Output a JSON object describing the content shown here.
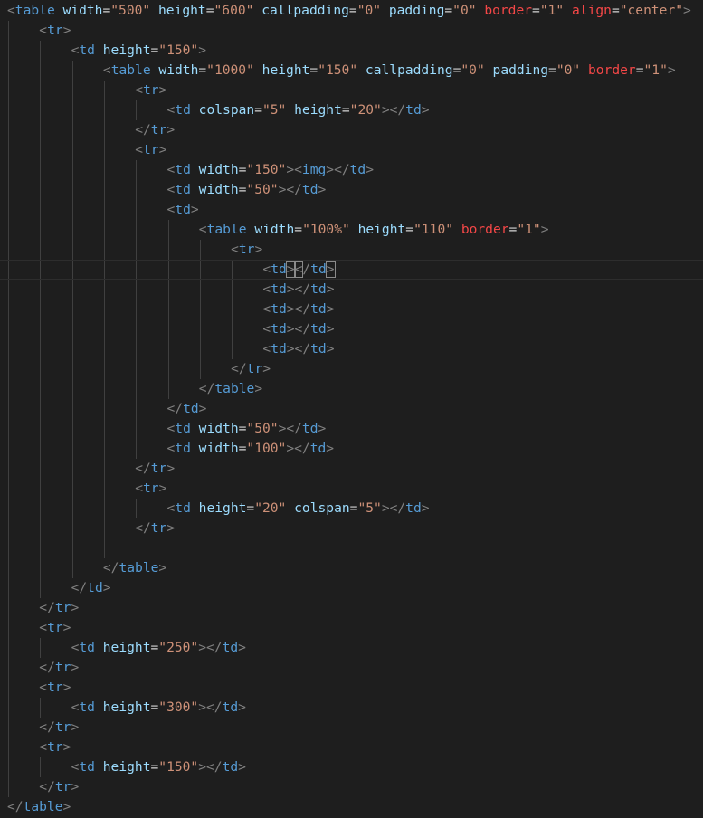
{
  "theme": {
    "background": "#1e1e1e",
    "bracket": "#808080",
    "tag": "#569cd6",
    "attribute": "#9cdcfe",
    "invalid_attribute": "#f44747",
    "string": "#ce9178",
    "text": "#d4d4d4"
  },
  "code_lines": [
    {
      "indent": 0,
      "tokens": [
        {
          "t": "br",
          "v": "<"
        },
        {
          "t": "tag",
          "v": "table"
        },
        {
          "t": "txt",
          "v": " "
        },
        {
          "t": "attr",
          "v": "width"
        },
        {
          "t": "txt",
          "v": "="
        },
        {
          "t": "val",
          "v": "\"500\""
        },
        {
          "t": "txt",
          "v": " "
        },
        {
          "t": "attr",
          "v": "height"
        },
        {
          "t": "txt",
          "v": "="
        },
        {
          "t": "val",
          "v": "\"600\""
        },
        {
          "t": "txt",
          "v": " "
        },
        {
          "t": "attr",
          "v": "callpadding"
        },
        {
          "t": "txt",
          "v": "="
        },
        {
          "t": "val",
          "v": "\"0\""
        },
        {
          "t": "txt",
          "v": " "
        },
        {
          "t": "attr",
          "v": "padding"
        },
        {
          "t": "txt",
          "v": "="
        },
        {
          "t": "val",
          "v": "\"0\""
        },
        {
          "t": "txt",
          "v": " "
        },
        {
          "t": "attr-red",
          "v": "border"
        },
        {
          "t": "txt",
          "v": "="
        },
        {
          "t": "val",
          "v": "\"1\""
        },
        {
          "t": "txt",
          "v": " "
        },
        {
          "t": "attr-red",
          "v": "align"
        },
        {
          "t": "txt",
          "v": "="
        },
        {
          "t": "val",
          "v": "\"center\""
        },
        {
          "t": "br",
          "v": ">"
        }
      ]
    },
    {
      "indent": 1,
      "tokens": [
        {
          "t": "br",
          "v": "<"
        },
        {
          "t": "tag",
          "v": "tr"
        },
        {
          "t": "br",
          "v": ">"
        }
      ]
    },
    {
      "indent": 2,
      "tokens": [
        {
          "t": "br",
          "v": "<"
        },
        {
          "t": "tag",
          "v": "td"
        },
        {
          "t": "txt",
          "v": " "
        },
        {
          "t": "attr",
          "v": "height"
        },
        {
          "t": "txt",
          "v": "="
        },
        {
          "t": "val",
          "v": "\"150\""
        },
        {
          "t": "br",
          "v": ">"
        }
      ]
    },
    {
      "indent": 3,
      "tokens": [
        {
          "t": "br",
          "v": "<"
        },
        {
          "t": "tag",
          "v": "table"
        },
        {
          "t": "txt",
          "v": " "
        },
        {
          "t": "attr",
          "v": "width"
        },
        {
          "t": "txt",
          "v": "="
        },
        {
          "t": "val",
          "v": "\"1000\""
        },
        {
          "t": "txt",
          "v": " "
        },
        {
          "t": "attr",
          "v": "height"
        },
        {
          "t": "txt",
          "v": "="
        },
        {
          "t": "val",
          "v": "\"150\""
        },
        {
          "t": "txt",
          "v": " "
        },
        {
          "t": "attr",
          "v": "callpadding"
        },
        {
          "t": "txt",
          "v": "="
        },
        {
          "t": "val",
          "v": "\"0\""
        },
        {
          "t": "txt",
          "v": " "
        },
        {
          "t": "attr",
          "v": "padding"
        },
        {
          "t": "txt",
          "v": "="
        },
        {
          "t": "val",
          "v": "\"0\""
        },
        {
          "t": "txt",
          "v": " "
        },
        {
          "t": "attr-red",
          "v": "border"
        },
        {
          "t": "txt",
          "v": "="
        },
        {
          "t": "val",
          "v": "\"1\""
        },
        {
          "t": "br",
          "v": ">"
        }
      ]
    },
    {
      "indent": 4,
      "tokens": [
        {
          "t": "br",
          "v": "<"
        },
        {
          "t": "tag",
          "v": "tr"
        },
        {
          "t": "br",
          "v": ">"
        }
      ]
    },
    {
      "indent": 5,
      "tokens": [
        {
          "t": "br",
          "v": "<"
        },
        {
          "t": "tag",
          "v": "td"
        },
        {
          "t": "txt",
          "v": " "
        },
        {
          "t": "attr",
          "v": "colspan"
        },
        {
          "t": "txt",
          "v": "="
        },
        {
          "t": "val",
          "v": "\"5\""
        },
        {
          "t": "txt",
          "v": " "
        },
        {
          "t": "attr",
          "v": "height"
        },
        {
          "t": "txt",
          "v": "="
        },
        {
          "t": "val",
          "v": "\"20\""
        },
        {
          "t": "br",
          "v": "></"
        },
        {
          "t": "tag",
          "v": "td"
        },
        {
          "t": "br",
          "v": ">"
        }
      ]
    },
    {
      "indent": 4,
      "tokens": [
        {
          "t": "br",
          "v": "</"
        },
        {
          "t": "tag",
          "v": "tr"
        },
        {
          "t": "br",
          "v": ">"
        }
      ]
    },
    {
      "indent": 4,
      "tokens": [
        {
          "t": "br",
          "v": "<"
        },
        {
          "t": "tag",
          "v": "tr"
        },
        {
          "t": "br",
          "v": ">"
        }
      ]
    },
    {
      "indent": 5,
      "tokens": [
        {
          "t": "br",
          "v": "<"
        },
        {
          "t": "tag",
          "v": "td"
        },
        {
          "t": "txt",
          "v": " "
        },
        {
          "t": "attr",
          "v": "width"
        },
        {
          "t": "txt",
          "v": "="
        },
        {
          "t": "val",
          "v": "\"150\""
        },
        {
          "t": "br",
          "v": "><"
        },
        {
          "t": "tag",
          "v": "img"
        },
        {
          "t": "br",
          "v": "></"
        },
        {
          "t": "tag",
          "v": "td"
        },
        {
          "t": "br",
          "v": ">"
        }
      ]
    },
    {
      "indent": 5,
      "tokens": [
        {
          "t": "br",
          "v": "<"
        },
        {
          "t": "tag",
          "v": "td"
        },
        {
          "t": "txt",
          "v": " "
        },
        {
          "t": "attr",
          "v": "width"
        },
        {
          "t": "txt",
          "v": "="
        },
        {
          "t": "val",
          "v": "\"50\""
        },
        {
          "t": "br",
          "v": "></"
        },
        {
          "t": "tag",
          "v": "td"
        },
        {
          "t": "br",
          "v": ">"
        }
      ]
    },
    {
      "indent": 5,
      "tokens": [
        {
          "t": "br",
          "v": "<"
        },
        {
          "t": "tag",
          "v": "td"
        },
        {
          "t": "br",
          "v": ">"
        }
      ]
    },
    {
      "indent": 6,
      "tokens": [
        {
          "t": "br",
          "v": "<"
        },
        {
          "t": "tag",
          "v": "table"
        },
        {
          "t": "txt",
          "v": " "
        },
        {
          "t": "attr",
          "v": "width"
        },
        {
          "t": "txt",
          "v": "="
        },
        {
          "t": "val",
          "v": "\"100%\""
        },
        {
          "t": "txt",
          "v": " "
        },
        {
          "t": "attr",
          "v": "height"
        },
        {
          "t": "txt",
          "v": "="
        },
        {
          "t": "val",
          "v": "\"110\""
        },
        {
          "t": "txt",
          "v": " "
        },
        {
          "t": "attr-red",
          "v": "border"
        },
        {
          "t": "txt",
          "v": "="
        },
        {
          "t": "val",
          "v": "\"1\""
        },
        {
          "t": "br",
          "v": ">"
        }
      ]
    },
    {
      "indent": 7,
      "tokens": [
        {
          "t": "br",
          "v": "<"
        },
        {
          "t": "tag",
          "v": "tr"
        },
        {
          "t": "br",
          "v": ">"
        }
      ]
    },
    {
      "indent": 8,
      "cursor": true,
      "tokens": [
        {
          "t": "br",
          "v": "<"
        },
        {
          "t": "tag",
          "v": "td"
        },
        {
          "t": "br m",
          "v": ">"
        },
        {
          "t": "br m",
          "v": "<"
        },
        {
          "t": "br",
          "v": "/"
        },
        {
          "t": "tag",
          "v": "td"
        },
        {
          "t": "br m",
          "v": ">"
        }
      ]
    },
    {
      "indent": 8,
      "tokens": [
        {
          "t": "br",
          "v": "<"
        },
        {
          "t": "tag",
          "v": "td"
        },
        {
          "t": "br",
          "v": "></"
        },
        {
          "t": "tag",
          "v": "td"
        },
        {
          "t": "br",
          "v": ">"
        }
      ]
    },
    {
      "indent": 8,
      "tokens": [
        {
          "t": "br",
          "v": "<"
        },
        {
          "t": "tag",
          "v": "td"
        },
        {
          "t": "br",
          "v": "></"
        },
        {
          "t": "tag",
          "v": "td"
        },
        {
          "t": "br",
          "v": ">"
        }
      ]
    },
    {
      "indent": 8,
      "tokens": [
        {
          "t": "br",
          "v": "<"
        },
        {
          "t": "tag",
          "v": "td"
        },
        {
          "t": "br",
          "v": "></"
        },
        {
          "t": "tag",
          "v": "td"
        },
        {
          "t": "br",
          "v": ">"
        }
      ]
    },
    {
      "indent": 8,
      "tokens": [
        {
          "t": "br",
          "v": "<"
        },
        {
          "t": "tag",
          "v": "td"
        },
        {
          "t": "br",
          "v": "></"
        },
        {
          "t": "tag",
          "v": "td"
        },
        {
          "t": "br",
          "v": ">"
        }
      ]
    },
    {
      "indent": 7,
      "tokens": [
        {
          "t": "br",
          "v": "</"
        },
        {
          "t": "tag",
          "v": "tr"
        },
        {
          "t": "br",
          "v": ">"
        }
      ]
    },
    {
      "indent": 6,
      "tokens": [
        {
          "t": "br",
          "v": "</"
        },
        {
          "t": "tag",
          "v": "table"
        },
        {
          "t": "br",
          "v": ">"
        }
      ]
    },
    {
      "indent": 5,
      "tokens": [
        {
          "t": "br",
          "v": "</"
        },
        {
          "t": "tag",
          "v": "td"
        },
        {
          "t": "br",
          "v": ">"
        }
      ]
    },
    {
      "indent": 5,
      "tokens": [
        {
          "t": "br",
          "v": "<"
        },
        {
          "t": "tag",
          "v": "td"
        },
        {
          "t": "txt",
          "v": " "
        },
        {
          "t": "attr",
          "v": "width"
        },
        {
          "t": "txt",
          "v": "="
        },
        {
          "t": "val",
          "v": "\"50\""
        },
        {
          "t": "br",
          "v": "></"
        },
        {
          "t": "tag",
          "v": "td"
        },
        {
          "t": "br",
          "v": ">"
        }
      ]
    },
    {
      "indent": 5,
      "tokens": [
        {
          "t": "br",
          "v": "<"
        },
        {
          "t": "tag",
          "v": "td"
        },
        {
          "t": "txt",
          "v": " "
        },
        {
          "t": "attr",
          "v": "width"
        },
        {
          "t": "txt",
          "v": "="
        },
        {
          "t": "val",
          "v": "\"100\""
        },
        {
          "t": "br",
          "v": "></"
        },
        {
          "t": "tag",
          "v": "td"
        },
        {
          "t": "br",
          "v": ">"
        }
      ]
    },
    {
      "indent": 4,
      "tokens": [
        {
          "t": "br",
          "v": "</"
        },
        {
          "t": "tag",
          "v": "tr"
        },
        {
          "t": "br",
          "v": ">"
        }
      ]
    },
    {
      "indent": 4,
      "tokens": [
        {
          "t": "br",
          "v": "<"
        },
        {
          "t": "tag",
          "v": "tr"
        },
        {
          "t": "br",
          "v": ">"
        }
      ]
    },
    {
      "indent": 5,
      "tokens": [
        {
          "t": "br",
          "v": "<"
        },
        {
          "t": "tag",
          "v": "td"
        },
        {
          "t": "txt",
          "v": " "
        },
        {
          "t": "attr",
          "v": "height"
        },
        {
          "t": "txt",
          "v": "="
        },
        {
          "t": "val",
          "v": "\"20\""
        },
        {
          "t": "txt",
          "v": " "
        },
        {
          "t": "attr",
          "v": "colspan"
        },
        {
          "t": "txt",
          "v": "="
        },
        {
          "t": "val",
          "v": "\"5\""
        },
        {
          "t": "br",
          "v": "></"
        },
        {
          "t": "tag",
          "v": "td"
        },
        {
          "t": "br",
          "v": ">"
        }
      ]
    },
    {
      "indent": 4,
      "tokens": [
        {
          "t": "br",
          "v": "</"
        },
        {
          "t": "tag",
          "v": "tr"
        },
        {
          "t": "br",
          "v": ">"
        }
      ]
    },
    {
      "indent": 3,
      "tokens": []
    },
    {
      "indent": 3,
      "tokens": [
        {
          "t": "br",
          "v": "</"
        },
        {
          "t": "tag",
          "v": "table"
        },
        {
          "t": "br",
          "v": ">"
        }
      ]
    },
    {
      "indent": 2,
      "tokens": [
        {
          "t": "br",
          "v": "</"
        },
        {
          "t": "tag",
          "v": "td"
        },
        {
          "t": "br",
          "v": ">"
        }
      ]
    },
    {
      "indent": 1,
      "tokens": [
        {
          "t": "br",
          "v": "</"
        },
        {
          "t": "tag",
          "v": "tr"
        },
        {
          "t": "br",
          "v": ">"
        }
      ]
    },
    {
      "indent": 1,
      "tokens": [
        {
          "t": "br",
          "v": "<"
        },
        {
          "t": "tag",
          "v": "tr"
        },
        {
          "t": "br",
          "v": ">"
        }
      ]
    },
    {
      "indent": 2,
      "tokens": [
        {
          "t": "br",
          "v": "<"
        },
        {
          "t": "tag",
          "v": "td"
        },
        {
          "t": "txt",
          "v": " "
        },
        {
          "t": "attr",
          "v": "height"
        },
        {
          "t": "txt",
          "v": "="
        },
        {
          "t": "val",
          "v": "\"250\""
        },
        {
          "t": "br",
          "v": "></"
        },
        {
          "t": "tag",
          "v": "td"
        },
        {
          "t": "br",
          "v": ">"
        }
      ]
    },
    {
      "indent": 1,
      "tokens": [
        {
          "t": "br",
          "v": "</"
        },
        {
          "t": "tag",
          "v": "tr"
        },
        {
          "t": "br",
          "v": ">"
        }
      ]
    },
    {
      "indent": 1,
      "tokens": [
        {
          "t": "br",
          "v": "<"
        },
        {
          "t": "tag",
          "v": "tr"
        },
        {
          "t": "br",
          "v": ">"
        }
      ]
    },
    {
      "indent": 2,
      "tokens": [
        {
          "t": "br",
          "v": "<"
        },
        {
          "t": "tag",
          "v": "td"
        },
        {
          "t": "txt",
          "v": " "
        },
        {
          "t": "attr",
          "v": "height"
        },
        {
          "t": "txt",
          "v": "="
        },
        {
          "t": "val",
          "v": "\"300\""
        },
        {
          "t": "br",
          "v": "></"
        },
        {
          "t": "tag",
          "v": "td"
        },
        {
          "t": "br",
          "v": ">"
        }
      ]
    },
    {
      "indent": 1,
      "tokens": [
        {
          "t": "br",
          "v": "</"
        },
        {
          "t": "tag",
          "v": "tr"
        },
        {
          "t": "br",
          "v": ">"
        }
      ]
    },
    {
      "indent": 1,
      "tokens": [
        {
          "t": "br",
          "v": "<"
        },
        {
          "t": "tag",
          "v": "tr"
        },
        {
          "t": "br",
          "v": ">"
        }
      ]
    },
    {
      "indent": 2,
      "tokens": [
        {
          "t": "br",
          "v": "<"
        },
        {
          "t": "tag",
          "v": "td"
        },
        {
          "t": "txt",
          "v": " "
        },
        {
          "t": "attr",
          "v": "height"
        },
        {
          "t": "txt",
          "v": "="
        },
        {
          "t": "val",
          "v": "\"150\""
        },
        {
          "t": "br",
          "v": "></"
        },
        {
          "t": "tag",
          "v": "td"
        },
        {
          "t": "br",
          "v": ">"
        }
      ]
    },
    {
      "indent": 1,
      "tokens": [
        {
          "t": "br",
          "v": "</"
        },
        {
          "t": "tag",
          "v": "tr"
        },
        {
          "t": "br",
          "v": ">"
        }
      ]
    },
    {
      "indent": 0,
      "tokens": [
        {
          "t": "br",
          "v": "</"
        },
        {
          "t": "tag",
          "v": "table"
        },
        {
          "t": "br",
          "v": ">"
        }
      ]
    }
  ]
}
